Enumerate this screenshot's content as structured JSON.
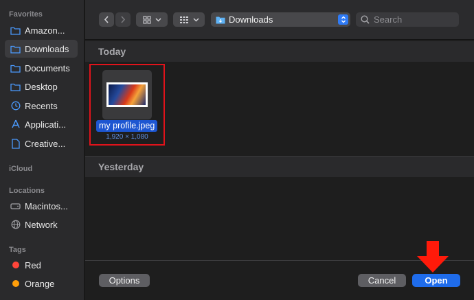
{
  "sidebar": {
    "sections": [
      {
        "title": "Favorites"
      },
      {
        "title": "iCloud"
      },
      {
        "title": "Locations"
      },
      {
        "title": "Tags"
      }
    ],
    "favorites": [
      {
        "label": "Amazon...",
        "icon": "folder-icon"
      },
      {
        "label": "Downloads",
        "icon": "folder-icon",
        "selected": true
      },
      {
        "label": "Documents",
        "icon": "folder-icon"
      },
      {
        "label": "Desktop",
        "icon": "folder-icon"
      },
      {
        "label": "Recents",
        "icon": "clock-icon"
      },
      {
        "label": "Applicati...",
        "icon": "applications-icon"
      },
      {
        "label": "Creative...",
        "icon": "document-icon"
      }
    ],
    "locations": [
      {
        "label": "Macintos...",
        "icon": "hard-drive-icon"
      },
      {
        "label": "Network",
        "icon": "globe-icon"
      }
    ],
    "tags": [
      {
        "label": "Red",
        "color": "#ff453a"
      },
      {
        "label": "Orange",
        "color": "#ff9f0a"
      }
    ]
  },
  "toolbar": {
    "path_label": "Downloads",
    "search_placeholder": "Search"
  },
  "groups": [
    {
      "title": "Today"
    },
    {
      "title": "Yesterday"
    }
  ],
  "file": {
    "name": "my profile.jpeg",
    "dimensions": "1,920 × 1,080"
  },
  "buttons": {
    "options": "Options",
    "cancel": "Cancel",
    "open": "Open"
  },
  "colors": {
    "accent": "#1f6ceb",
    "highlight_box": "#e1131b",
    "arrow": "#ff1a0a"
  }
}
